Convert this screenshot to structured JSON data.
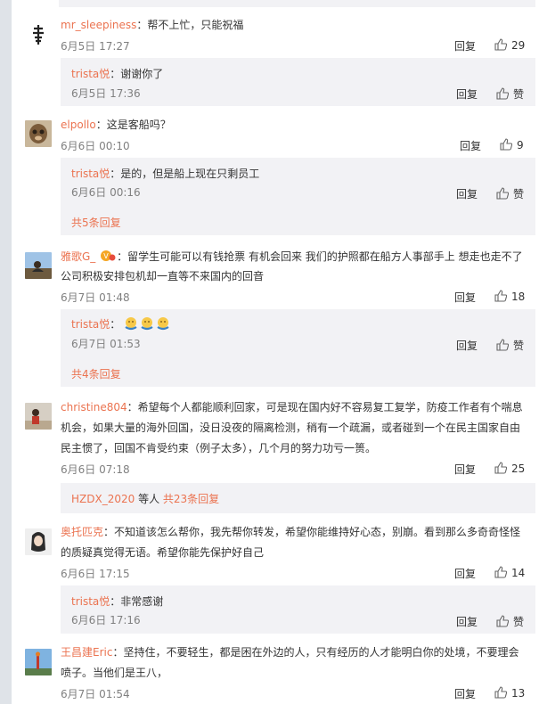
{
  "c1": {
    "user": "mr_sleepiness",
    "text": "：帮不上忙，只能祝福",
    "time": "6月5日 17:27",
    "reply": "回复",
    "likes": "29"
  },
  "r1": {
    "user": "trista悦",
    "text": "：谢谢你了",
    "time": "6月5日 17:36",
    "reply": "回复",
    "like": "赞"
  },
  "c2": {
    "user": "elpollo",
    "text": "：这是客船吗？",
    "time": "6月6日 00:10",
    "reply": "回复",
    "likes": "9"
  },
  "r2": {
    "user": "trista悦",
    "text": "：是的，但是船上现在只剩员工",
    "time": "6月6日 00:16",
    "reply": "回复",
    "like": "赞",
    "more": "共5条回复"
  },
  "c3": {
    "user": "雅歌G_",
    "line1": "：留学生可能可以有钱抢票 有机会回来 我们的护照都在船方人事部手上 想走也走不了",
    "line2": "公司积极安排包机却一直等不来国内的回音",
    "time": "6月7日 01:48",
    "reply": "回复",
    "likes": "18"
  },
  "r3": {
    "user": "trista悦",
    "text": "：",
    "time": "6月7日 01:53",
    "reply": "回复",
    "like": "赞",
    "more": "共4条回复"
  },
  "c4": {
    "user": "christine804",
    "line1": "：希望每个人都能顺利回家，可是现在国内好不容易复工复学，防疫工作者有个喘息",
    "line2": "机会，如果大量的海外回国，没日没夜的隔离检测，稍有一个疏漏，或者碰到一个在民主国家自由",
    "line3": "民主惯了，回国不肯受约束（例子太多），几个月的努力功亏一篑。",
    "time": "6月6日 07:18",
    "reply": "回复",
    "likes": "25"
  },
  "r4": {
    "user": "HZDX_2020",
    "mid": " 等人 ",
    "more": "共23条回复"
  },
  "c5": {
    "user": "奥托匹克",
    "line1": "：不知道该怎么帮你，我先帮你转发，希望你能维持好心态，别崩。看到那么多奇奇怪怪",
    "line2": "的质疑真觉得无语。希望你能先保护好自己",
    "time": "6月6日 17:15",
    "reply": "回复",
    "likes": "14"
  },
  "r5": {
    "user": "trista悦",
    "text": "：非常感谢",
    "time": "6月6日 17:16",
    "reply": "回复",
    "like": "赞"
  },
  "c6": {
    "user": "王昌建Eric",
    "line1": "：坚持住，不要轻生，都是困在外边的人，只有经历的人才能明白你的处境，不要理会",
    "line2": "喷子。当他们是王八，",
    "time": "6月7日 01:54",
    "reply": "回复",
    "likes": "13"
  },
  "colors": {
    "accent": "#eb7350",
    "meta": "#808080",
    "reply_bg": "#f2f2f5"
  }
}
